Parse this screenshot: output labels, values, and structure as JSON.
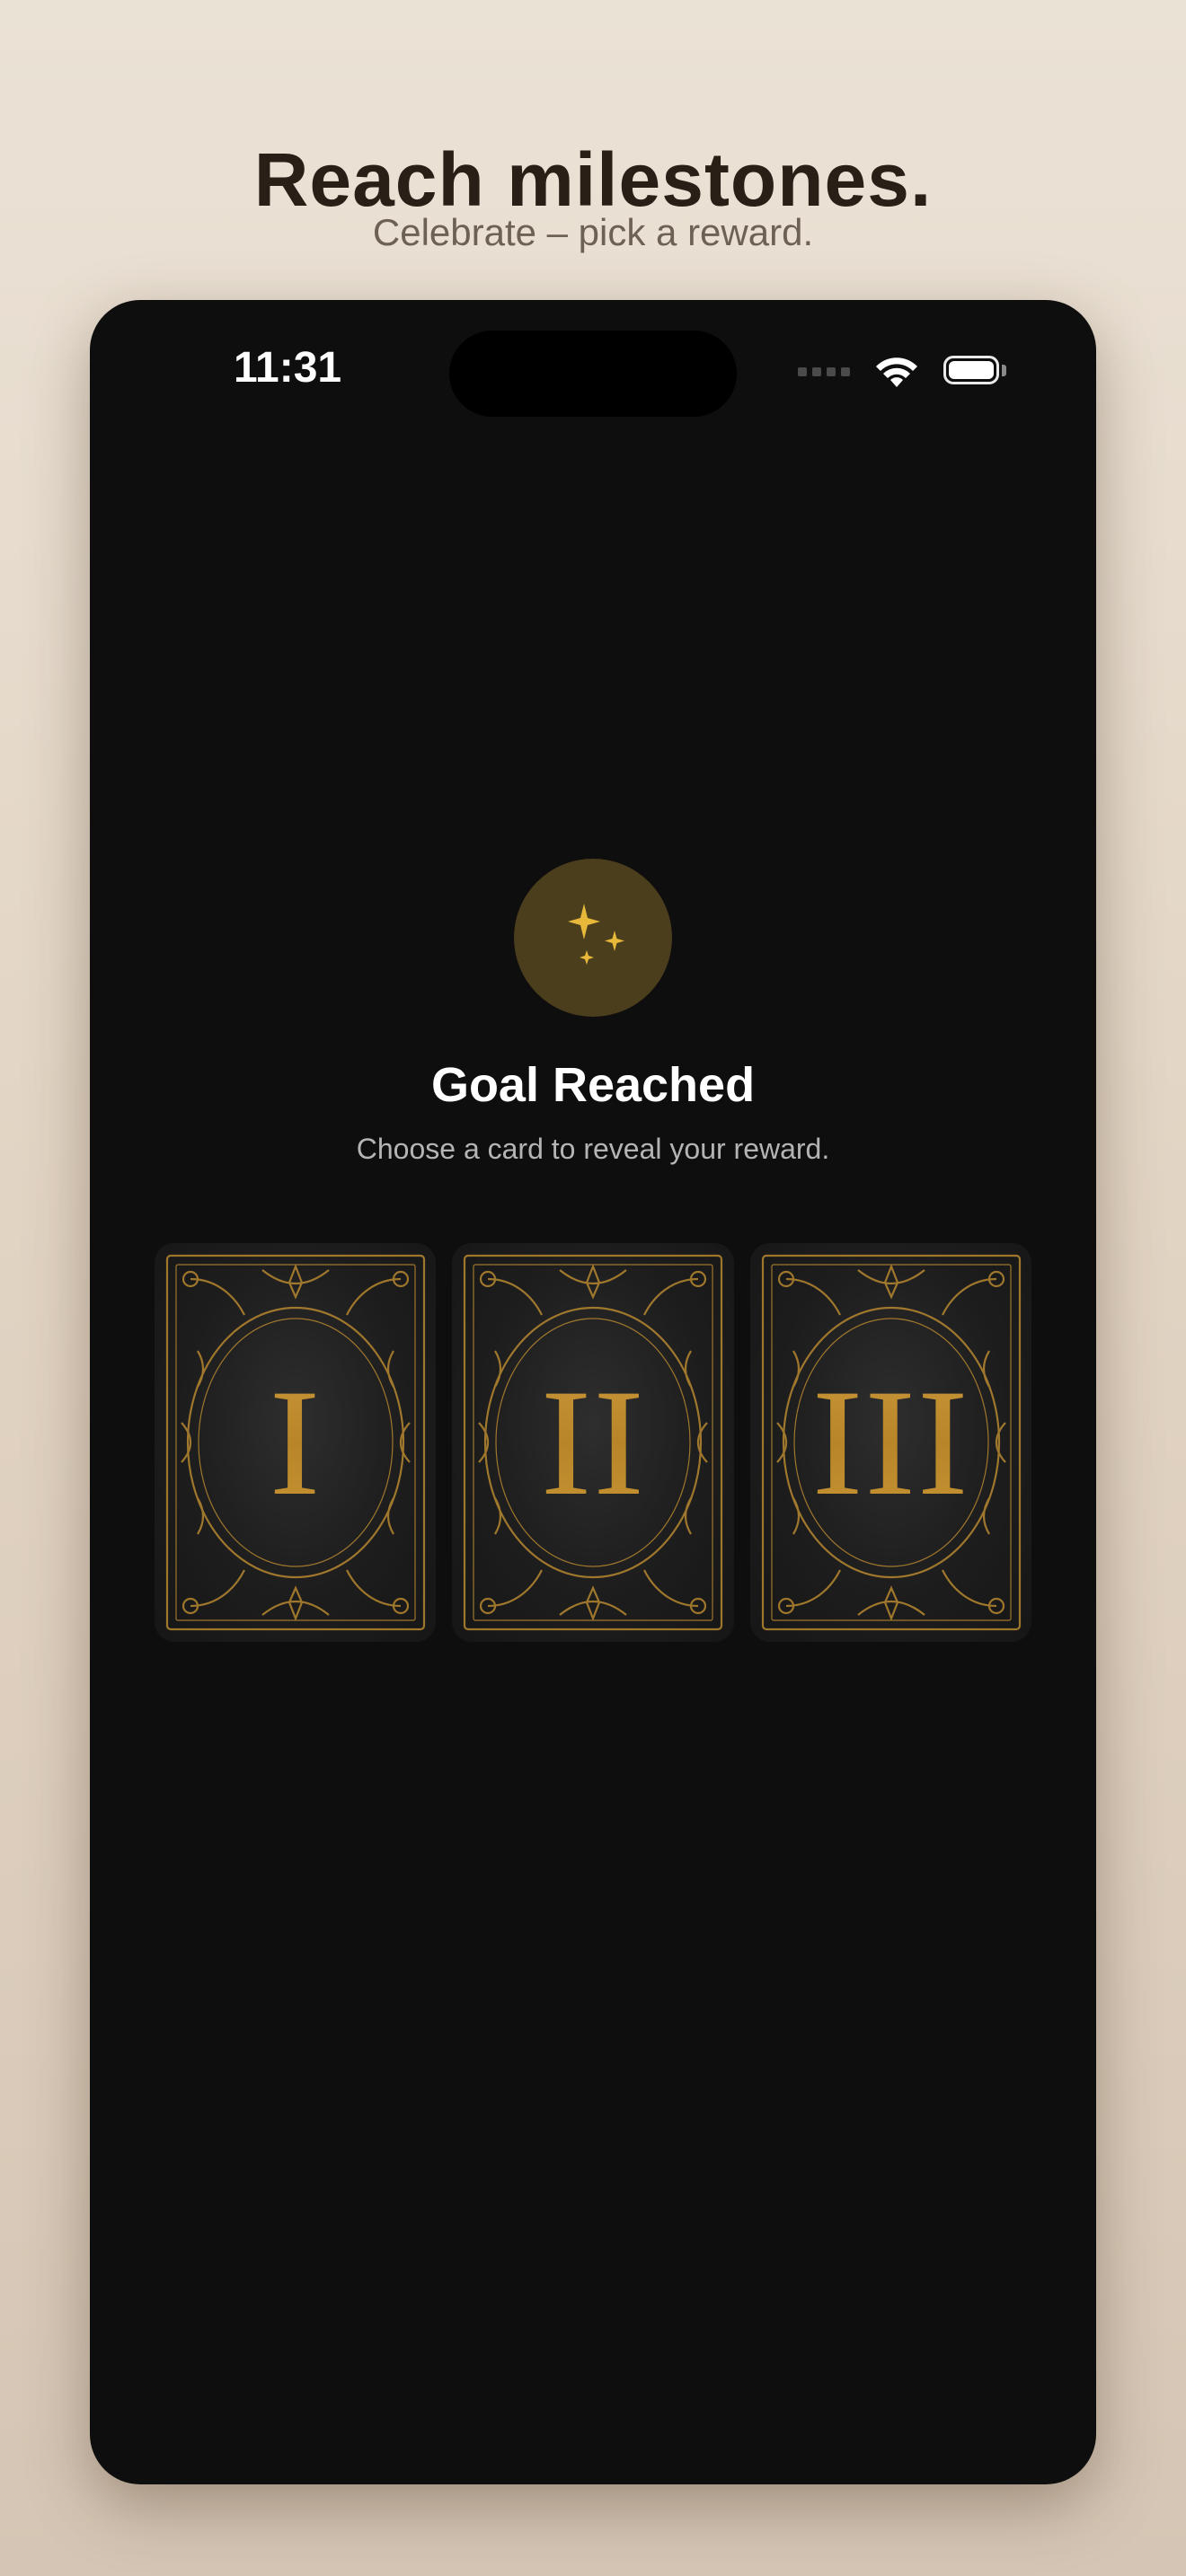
{
  "promo": {
    "headline": "Reach milestones.",
    "subheadline": "Celebrate – pick a reward."
  },
  "status_bar": {
    "time": "11:31",
    "icons": [
      "signal-icon",
      "wifi-icon",
      "battery-icon"
    ]
  },
  "screen": {
    "badge_icon": "sparkles-icon",
    "title": "Goal Reached",
    "subtitle": "Choose a card to reveal your reward."
  },
  "cards": [
    {
      "numeral": "I"
    },
    {
      "numeral": "II"
    },
    {
      "numeral": "III"
    }
  ],
  "colors": {
    "background_top": "#ebe2d6",
    "background_bottom": "#d5c5b4",
    "phone_screen": "#0e0e0e",
    "badge": "#4b3e1c",
    "gold": "#c99a3a",
    "sparkle": "#e8b83a"
  }
}
